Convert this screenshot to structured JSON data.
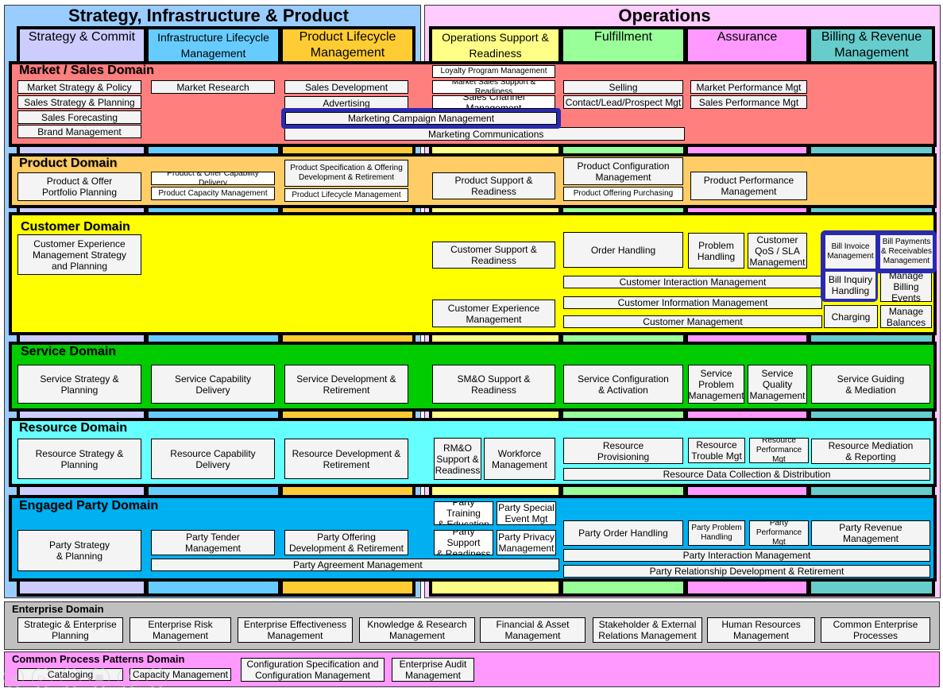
{
  "groups": {
    "left_title": "Strategy, Infrastructure & Product",
    "right_title": "Operations"
  },
  "verticals": [
    {
      "label": "Strategy &\nCommit",
      "color": "#ccccff"
    },
    {
      "label": "Infrastructure Lifecycle\nManagement",
      "color": "#66ccff"
    },
    {
      "label": "Product Lifecycle\nManagement",
      "color": "#ffcc33"
    },
    {
      "label": "Operations\nSupport & Readiness",
      "color": "#ffff88"
    },
    {
      "label": "Fulfillment",
      "color": "#99ff99"
    },
    {
      "label": "Assurance",
      "color": "#ff99ff"
    },
    {
      "label": "Billing & Revenue\nManagement",
      "color": "#66cccc"
    }
  ],
  "domains": {
    "market_sales": {
      "title": "Market / Sales Domain",
      "color": "#ff7f7f",
      "boxes": [
        "Market Strategy & Policy",
        "Sales Strategy & Planning",
        "Sales Forecasting",
        "Brand Management",
        "Market Research",
        "Sales Development",
        "Advertising",
        "Marketing Campaign Management",
        "Marketing Communications",
        "Loyalty Program Management",
        "Market Sales Support & Readiness",
        "Sales Channel Management",
        "Selling",
        "Contact/Lead/Prospect Mgt",
        "Market Performance Mgt",
        "Sales Performance Mgt"
      ]
    },
    "product": {
      "title": "Product Domain",
      "color": "#ffcc66",
      "boxes": [
        "Product & Offer\nPortfolio Planning",
        "Product & Offer Capability Delivery",
        "Product Capacity Management",
        "Product Specification & Offering\nDevelopment & Retirement",
        "Product Lifecycle Management",
        "Product Support &\nReadiness",
        "Product Configuration\nManagement",
        "Product Offering Purchasing",
        "Product Performance\nManagement"
      ]
    },
    "customer": {
      "title": "Customer Domain",
      "color": "#ffff00",
      "boxes": [
        "Customer Experience\nManagement Strategy\nand Planning",
        "Customer Support &\nReadiness",
        "Customer Experience\nManagement",
        "Order Handling",
        "Problem\nHandling",
        "Customer\nQoS / SLA\nManagement",
        "Customer Interaction Management",
        "Customer Information Management",
        "Customer Management",
        "Bill Invoice\nManagement",
        "Bill Payments\n& Receivables\nManagement",
        "Bill Inquiry\nHandling",
        "Manage\nBilling\nEvents",
        "Charging",
        "Manage\nBalances"
      ]
    },
    "service": {
      "title": "Service Domain",
      "color": "#00cc00",
      "boxes": [
        "Service Strategy &\nPlanning",
        "Service Capability\nDelivery",
        "Service Development &\nRetirement",
        "SM&O Support &\nReadiness",
        "Service Configuration\n& Activation",
        "Service\nProblem\nManagement",
        "Service\nQuality\nManagement",
        "Service Guiding\n& Mediation"
      ]
    },
    "resource": {
      "title": "Resource Domain",
      "color": "#66ffff",
      "boxes": [
        "Resource Strategy &\nPlanning",
        "Resource Capability\nDelivery",
        "Resource  Development &\nRetirement",
        "RM&O\nSupport &\nReadiness",
        "Workforce\nManagement",
        "Resource\nProvisioning",
        "Resource\nTrouble Mgt",
        "Resource\nPerformance Mgt",
        "Resource Mediation\n& Reporting",
        "Resource Data Collection & Distribution"
      ]
    },
    "engaged_party": {
      "title": "Engaged Party Domain",
      "color": "#00b0f0",
      "boxes": [
        "Party Strategy\n& Planning",
        "Party Tender\nManagement",
        "Party Offering\nDevelopment & Retirement",
        "Party Agreement Management",
        "Party Training\n& Education",
        "Party Special\nEvent Mgt",
        "Party Support\n& Readiness",
        "Party Privacy\nManagement",
        "Party Order Handling",
        "Party Problem\nHandling",
        "Party\nPerformance Mgt",
        "Party Revenue\nManagement",
        "Party Interaction Management",
        "Party Relationship Development & Retirement"
      ]
    }
  },
  "enterprise": {
    "title": "Enterprise Domain",
    "boxes": [
      "Strategic & Enterprise\nPlanning",
      "Enterprise Risk\nManagement",
      "Enterprise Effectiveness\nManagement",
      "Knowledge & Research\nManagement",
      "Financial & Asset\nManagement",
      "Stakeholder & External\nRelations Management",
      "Human Resources\nManagement",
      "Common Enterprise\nProcesses"
    ]
  },
  "common_patterns": {
    "title": "Common Process Patterns Domain",
    "boxes": [
      "Cataloging",
      "Capacity Management",
      "Configuration Specification and\nConfiguration Management",
      "Enterprise Audit\nManagement"
    ]
  },
  "nav_controls": [
    "previous-icon",
    "next-icon",
    "pen-icon",
    "slides-icon",
    "zoom-icon",
    "more-icon"
  ],
  "highlight_color": "#2a2ab0"
}
